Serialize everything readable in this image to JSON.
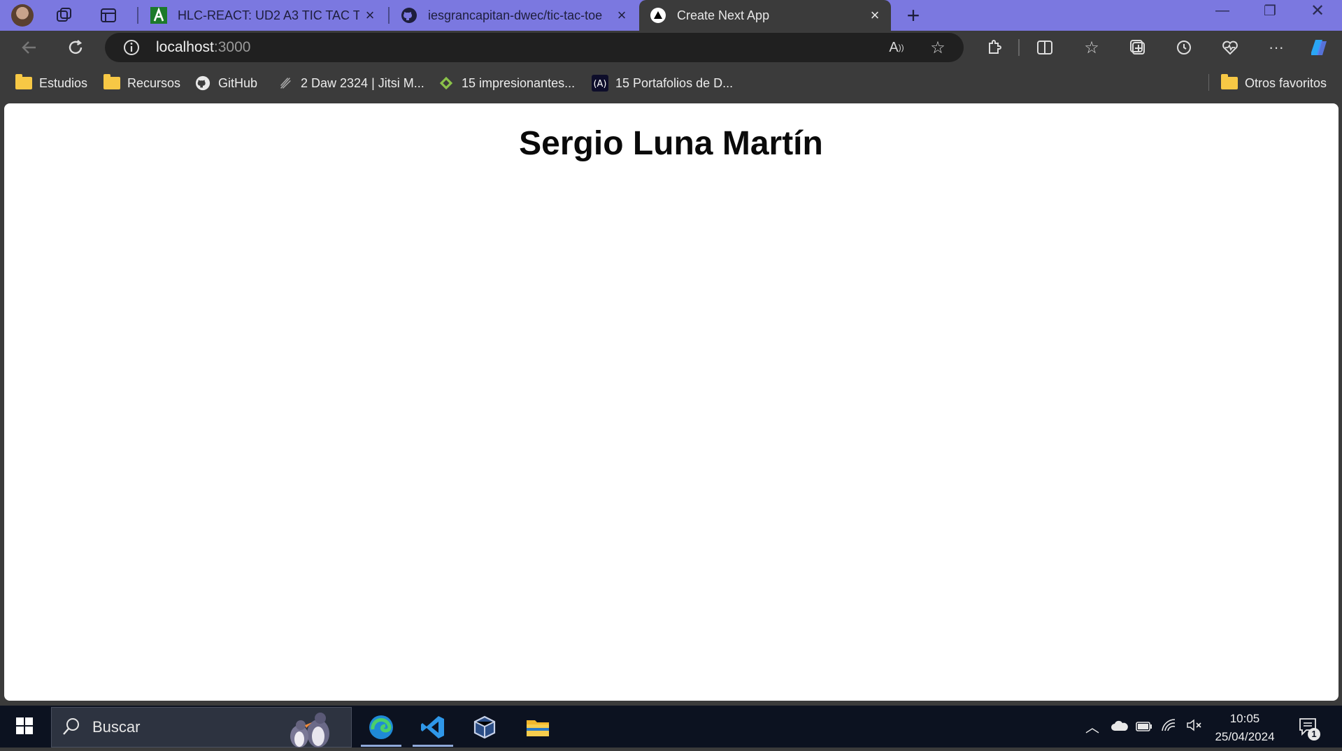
{
  "tabs": [
    {
      "title": "HLC-REACT: UD2 A3 TIC TAC TOE",
      "icon": "brand-a-icon"
    },
    {
      "title": "iesgrancapitan-dwec/tic-tac-toe",
      "icon": "github-icon"
    },
    {
      "title": "Create Next App",
      "icon": "nextjs-icon",
      "active": true
    }
  ],
  "address": {
    "host": "localhost",
    "port": ":3000"
  },
  "bookmarks": [
    {
      "label": "Estudios",
      "icon": "folder-icon"
    },
    {
      "label": "Recursos",
      "icon": "folder-icon"
    },
    {
      "label": "GitHub",
      "icon": "github-icon"
    },
    {
      "label": "2 Daw 2324 | Jitsi M...",
      "icon": "jitsi-icon"
    },
    {
      "label": "15 impresionantes...",
      "icon": "diamond-icon"
    },
    {
      "label": "15 Portafolios de D...",
      "icon": "astro-icon"
    }
  ],
  "other_favorites": "Otros favoritos",
  "page": {
    "heading": "Sergio Luna Martín"
  },
  "taskbar": {
    "search_placeholder": "Buscar",
    "time": "10:05",
    "date": "25/04/2024",
    "notification_count": "1"
  },
  "colors": {
    "titlebar": "#7b78e0",
    "chrome": "#3b3b3b",
    "taskbar": "#0c1220"
  }
}
